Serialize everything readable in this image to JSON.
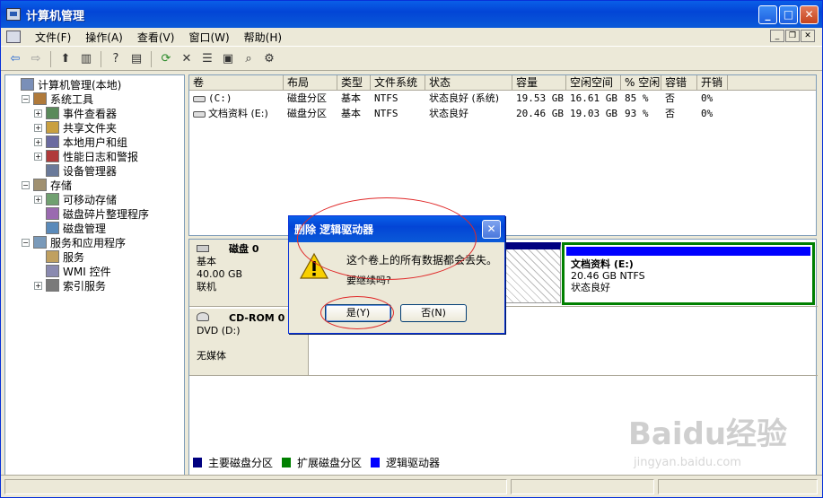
{
  "window": {
    "title": "计算机管理"
  },
  "menu": [
    "文件(F)",
    "操作(A)",
    "查看(V)",
    "窗口(W)",
    "帮助(H)"
  ],
  "tree": [
    {
      "label": "计算机管理(本地)",
      "indent": 0,
      "tog": ""
    },
    {
      "label": "系统工具",
      "indent": 1,
      "tog": "−"
    },
    {
      "label": "事件查看器",
      "indent": 2,
      "tog": "+"
    },
    {
      "label": "共享文件夹",
      "indent": 2,
      "tog": "+"
    },
    {
      "label": "本地用户和组",
      "indent": 2,
      "tog": "+"
    },
    {
      "label": "性能日志和警报",
      "indent": 2,
      "tog": "+"
    },
    {
      "label": "设备管理器",
      "indent": 2,
      "tog": ""
    },
    {
      "label": "存储",
      "indent": 1,
      "tog": "−"
    },
    {
      "label": "可移动存储",
      "indent": 2,
      "tog": "+"
    },
    {
      "label": "磁盘碎片整理程序",
      "indent": 2,
      "tog": ""
    },
    {
      "label": "磁盘管理",
      "indent": 2,
      "tog": ""
    },
    {
      "label": "服务和应用程序",
      "indent": 1,
      "tog": "−"
    },
    {
      "label": "服务",
      "indent": 2,
      "tog": ""
    },
    {
      "label": "WMI 控件",
      "indent": 2,
      "tog": ""
    },
    {
      "label": "索引服务",
      "indent": 2,
      "tog": "+"
    }
  ],
  "columns": [
    "卷",
    "布局",
    "类型",
    "文件系统",
    "状态",
    "容量",
    "空闲空间",
    "% 空闲",
    "容错",
    "开销"
  ],
  "volumes": [
    [
      "(C:)",
      "磁盘分区",
      "基本",
      "NTFS",
      "状态良好 (系统)",
      "19.53 GB",
      "16.61 GB",
      "85 %",
      "否",
      "0%"
    ],
    [
      "文档资料 (E:)",
      "磁盘分区",
      "基本",
      "NTFS",
      "状态良好",
      "20.46 GB",
      "19.03 GB",
      "93 %",
      "否",
      "0%"
    ]
  ],
  "disk0": {
    "name": "磁盘 0",
    "type": "基本",
    "size": "40.00 GB",
    "status": "联机"
  },
  "partE": {
    "name": "文档资料  (E:)",
    "size": "20.46 GB NTFS",
    "status": "状态良好"
  },
  "cdrom": {
    "name": "CD-ROM 0",
    "type": "DVD (D:)",
    "status": "无媒体"
  },
  "legend": [
    "主要磁盘分区",
    "扩展磁盘分区",
    "逻辑驱动器"
  ],
  "legend_colors": [
    "#000080",
    "#008000",
    "#0000ff"
  ],
  "dialog": {
    "title": "删除 逻辑驱动器",
    "message": "这个卷上的所有数据都会丢失。",
    "question": "要继续吗?",
    "yes": "是(Y)",
    "no": "否(N)"
  },
  "watermark": {
    "brand": "Baidu经验",
    "url": "jingyan.baidu.com"
  }
}
